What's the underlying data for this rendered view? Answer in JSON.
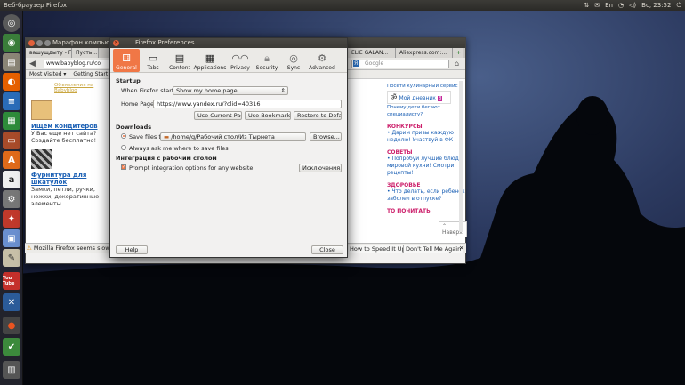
{
  "top_panel": {
    "title": "Веб-браузер Firefox",
    "clock": "Вс, 23:52",
    "tray_icons": [
      "sort-icon",
      "email-icon",
      "keyboard-icon",
      "wifi-icon",
      "volume-icon",
      "power-icon"
    ]
  },
  "launcher": {
    "items": [
      "ubuntu-dash-icon",
      "chrome-icon",
      "files-icon",
      "firefox-icon",
      "libreoffice-writer-icon",
      "libreoffice-calc-icon",
      "libreoffice-impress-icon",
      "software-center-icon",
      "amazon-icon",
      "settings-icon",
      "terminal-icon",
      "video-icon",
      "text-editor-icon",
      "youtube-icon",
      "inkscape-icon",
      "font-icon",
      "gedit-icon",
      "trash-icon"
    ],
    "youtube_label": "You Tube"
  },
  "browser": {
    "window_title": "Марафон компьютерн...",
    "tabs": [
      "вашущдыту - П...",
      "Пусть...",
      "ELIE GALAN...",
      "Aliexpress.com:...",
      "+"
    ],
    "url": "www.babyblog.ru/co",
    "search_placeholder": "Google",
    "bookmarks": [
      "Most Visited ▾",
      "Getting Start"
    ],
    "page_left": {
      "top_link": "Объявления на Babyblog",
      "item1_title": "Ищем кондитеров",
      "item1_text": "У Вас еще нет сайта? Создайте бесплатно!",
      "item2_title": "Фурнитура для шкатулок",
      "item2_text": "Замки, петли, ручки, ножки, декоративные элементы"
    },
    "page_right": {
      "top_text": "Посети кулинарный сервис",
      "diary": "Мой дневник",
      "diary_badge": "8",
      "text2": "Почему дети бегают специалисту?",
      "sections": [
        {
          "head": "КОНКУРСЫ",
          "item": "• Дарим призы каждую неделю! Участвуй в ФК"
        },
        {
          "head": "СОВЕТЫ",
          "item": "• Попробуй лучшие блюда мировой кухни! Смотри рецепты!"
        },
        {
          "head": "ЗДОРОВЬЕ",
          "item": "• Что делать, если ребенок заболел в отпуске?"
        },
        {
          "head": "ТО ПОЧИТАТЬ",
          "item": ""
        }
      ],
      "back_top": "Наверх"
    },
    "notification": {
      "text": "Mozilla Firefox seems slow... to",
      "speed_button": "How to Speed It Up",
      "dont_tell_button": "Don't Tell Me Again"
    }
  },
  "prefs": {
    "title": "Firefox Preferences",
    "panes": [
      {
        "label": "General",
        "icon": "general-icon"
      },
      {
        "label": "Tabs",
        "icon": "tabs-icon"
      },
      {
        "label": "Content",
        "icon": "content-icon"
      },
      {
        "label": "Applications",
        "icon": "applications-icon"
      },
      {
        "label": "Privacy",
        "icon": "privacy-icon"
      },
      {
        "label": "Security",
        "icon": "security-icon"
      },
      {
        "label": "Sync",
        "icon": "sync-icon"
      },
      {
        "label": "Advanced",
        "icon": "advanced-icon"
      }
    ],
    "startup_head": "Startup",
    "when_starts_label": "When Firefox starts:",
    "when_starts_value": "Show my home page",
    "homepage_label": "Home Page:",
    "homepage_value": "https://www.yandex.ru/?clid=40316",
    "use_current": "Use Current Pages",
    "use_bookmark": "Use Bookmark...",
    "restore_default": "Restore to Default",
    "downloads_head": "Downloads",
    "save_files_label": "Save files to",
    "save_path": "/home/g/Рабочий стол/Из Тырнета",
    "browse": "Browse...",
    "always_ask": "Always ask me where to save files",
    "integration_head": "Интеграция с рабочим столом",
    "prompt_integration": "Prompt integration options for any website",
    "exceptions": "Исключения...",
    "help": "Help",
    "close": "Close"
  }
}
